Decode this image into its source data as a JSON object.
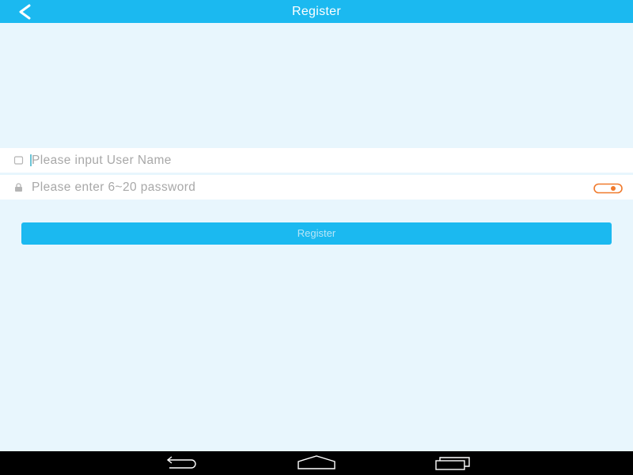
{
  "header": {
    "title": "Register",
    "back_icon": "chevron-left-icon"
  },
  "form": {
    "username": {
      "placeholder": "Please input User Name",
      "value": "",
      "icon": "user-icon"
    },
    "password": {
      "placeholder": "Please enter 6~20 password",
      "value": "",
      "icon": "lock-icon",
      "toggle_icon": "eye-toggle-icon"
    },
    "submit_label": "Register"
  },
  "navbar": {
    "back_icon": "back-icon",
    "home_icon": "home-icon",
    "recent_icon": "recent-apps-icon"
  },
  "colors": {
    "accent": "#1bb9f0",
    "background": "#e8f6fd",
    "toggle": "#f07a2c",
    "navbar": "#000000"
  }
}
